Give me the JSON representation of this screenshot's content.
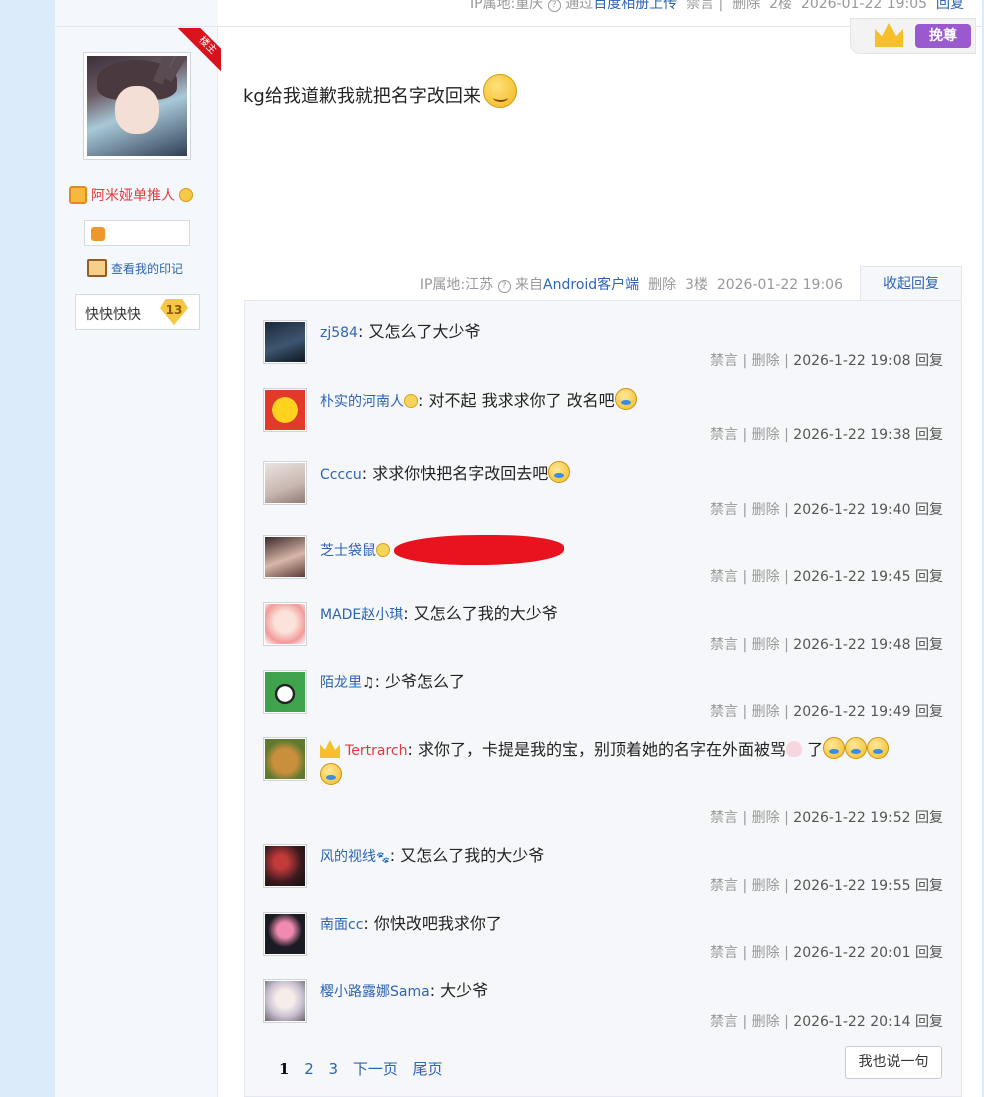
{
  "top_meta": {
    "ip_label": "IP属地:重庆",
    "via": "通过",
    "via_source": "百度相册上传",
    "ban": "禁言",
    "delete": "删除",
    "floor": "2楼",
    "datetime": "2026-01-22 19:05",
    "reply": "回复"
  },
  "author": {
    "name": "阿米娅单推人",
    "mark_link": "查看我的印记",
    "forum_name": "快快快快",
    "level": "13",
    "ribbon": "楼主"
  },
  "crown_badge": {
    "button": "挽尊"
  },
  "post": {
    "text": "kg给我道歉我就把名字改回来",
    "ip_label": "IP属地:江苏",
    "from_prefix": "来自",
    "from_source": "Android客户端",
    "delete": "删除",
    "floor": "3楼",
    "datetime": "2026-01-22 19:06",
    "collapse": "收起回复"
  },
  "replies": [
    {
      "name": "zj584",
      "text": "又怎么了大少爷",
      "datetime": "2026-1-22 19:08"
    },
    {
      "name": "朴实的河南人",
      "text": "对不起 我求求你了 改名吧",
      "datetime": "2026-1-22 19:38"
    },
    {
      "name": "Ccccu",
      "text": "求求你快把名字改回去吧",
      "datetime": "2026-1-22 19:40"
    },
    {
      "name": "芝士袋鼠",
      "text": "",
      "datetime": "2026-1-22 19:45"
    },
    {
      "name": "MADE赵小琪",
      "text": "又怎么了我的大少爷",
      "datetime": "2026-1-22 19:48"
    },
    {
      "name": "陌龙里",
      "text": "少爷怎么了",
      "datetime": "2026-1-22 19:49"
    },
    {
      "name": "Tertrarch",
      "text": "求你了，卡提是我的宝，别顶着她的名字在外面被骂",
      "text2": "了",
      "datetime": "2026-1-22 19:52"
    },
    {
      "name": "风的视线",
      "text": "又怎么了我的大少爷",
      "datetime": "2026-1-22 19:55"
    },
    {
      "name": "南面cc",
      "text": "你快改吧我求你了",
      "datetime": "2026-1-22 20:01"
    },
    {
      "name": "樱小路露娜Sama",
      "text": "大少爷",
      "datetime": "2026-1-22 20:14"
    }
  ],
  "reply_actions": {
    "ban": "禁言",
    "sep": "|",
    "delete": "删除",
    "reply": "回复"
  },
  "pager": {
    "current": "1",
    "p2": "2",
    "p3": "3",
    "next": "下一页",
    "last": "尾页"
  },
  "say_button": "我也说一句",
  "colors": {
    "link": "#2d64b3",
    "accent_red": "#e4393c",
    "crown_purple": "#9b59d0"
  },
  "icons": [
    "gift-icon",
    "emoji-icon",
    "book-icon",
    "crown-icon",
    "help-icon",
    "smiley-icon",
    "music-note-icon",
    "paw-icon",
    "chick-icon",
    "cheese-icon"
  ]
}
